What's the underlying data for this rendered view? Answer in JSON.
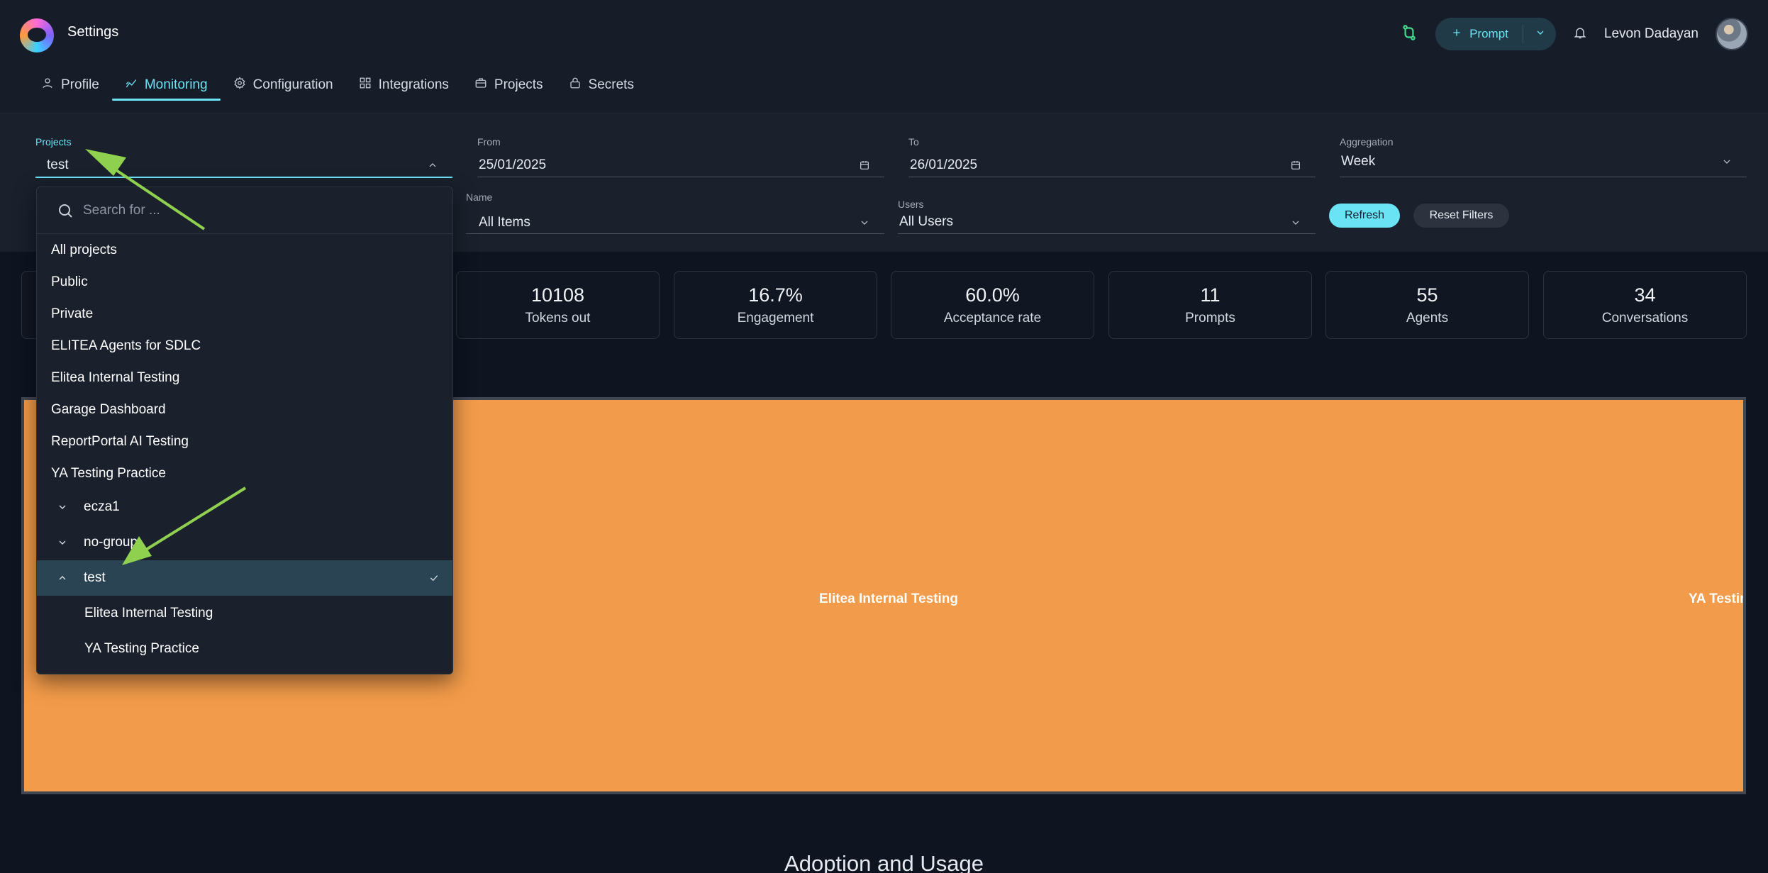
{
  "header": {
    "title": "Settings",
    "user_name": "Levon Dadayan",
    "prompt_button": "Prompt"
  },
  "tabs": [
    {
      "label": "Profile",
      "icon": "user-icon"
    },
    {
      "label": "Monitoring",
      "icon": "monitoring-icon",
      "active": true
    },
    {
      "label": "Configuration",
      "icon": "gear-icon"
    },
    {
      "label": "Integrations",
      "icon": "grid-icon"
    },
    {
      "label": "Projects",
      "icon": "briefcase-icon"
    },
    {
      "label": "Secrets",
      "icon": "lock-icon"
    }
  ],
  "filters": {
    "projects": {
      "label": "Projects",
      "value": "test"
    },
    "from": {
      "label": "From",
      "value": "25/01/2025"
    },
    "to": {
      "label": "To",
      "value": "26/01/2025"
    },
    "aggregation": {
      "label": "Aggregation",
      "value": "Week"
    },
    "name": {
      "label": "Name",
      "value": "All Items"
    },
    "users": {
      "label": "Users",
      "value": "All Users"
    },
    "refresh": "Refresh",
    "reset": "Reset Filters"
  },
  "stats": [
    {
      "value": "10108",
      "label": "Tokens out"
    },
    {
      "value": "16.7%",
      "label": "Engagement"
    },
    {
      "value": "60.0%",
      "label": "Acceptance rate"
    },
    {
      "value": "11",
      "label": "Prompts"
    },
    {
      "value": "55",
      "label": "Agents"
    },
    {
      "value": "34",
      "label": "Conversations"
    }
  ],
  "treemap": {
    "color": "#f29b4a",
    "labels": [
      "Elitea Internal Testing",
      "YA Testing"
    ]
  },
  "section_title": "Adoption and Usage",
  "dropdown": {
    "search_placeholder": "Search for ...",
    "items": [
      "All projects",
      "Public",
      "Private",
      "ELITEA Agents for SDLC",
      "Elitea Internal Testing",
      "Garage Dashboard",
      "ReportPortal AI Testing",
      "YA Testing Practice"
    ],
    "groups": [
      {
        "label": "ecza1",
        "expanded": false
      },
      {
        "label": "no-group",
        "expanded": false
      },
      {
        "label": "test",
        "expanded": true,
        "selected": true
      }
    ],
    "subitems": [
      "Elitea Internal Testing",
      "YA Testing Practice"
    ]
  },
  "colors": {
    "accent": "#6ae3f5",
    "annotation_arrow": "#8fd14f"
  }
}
